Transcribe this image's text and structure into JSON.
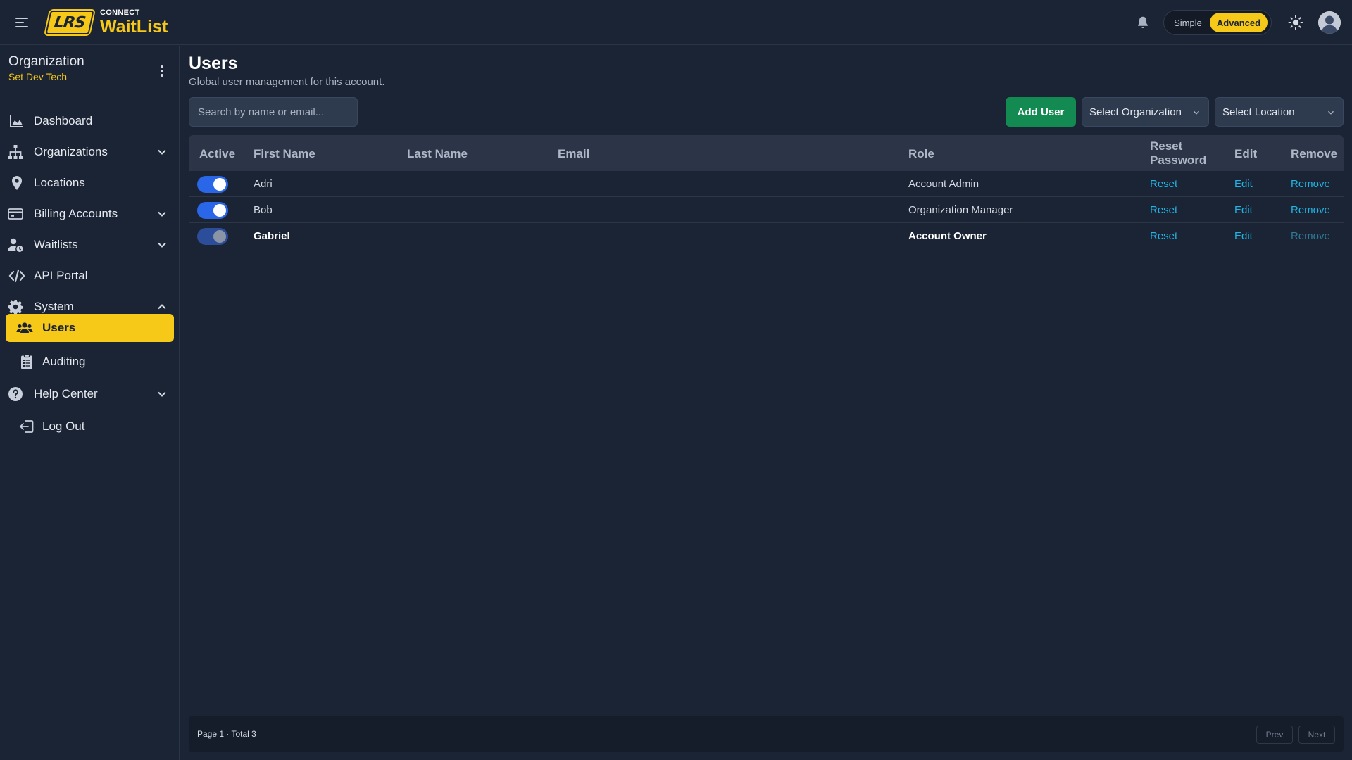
{
  "header": {
    "logo_text": "LRS",
    "brand_top": "CONNECT",
    "brand_main": "WaitList",
    "mode_simple": "Simple",
    "mode_advanced": "Advanced",
    "active_mode": "Advanced"
  },
  "sidebar": {
    "org_title": "Organization",
    "org_name": "Set Dev Tech",
    "items": [
      {
        "label": "Dashboard",
        "icon": "chart-area-icon"
      },
      {
        "label": "Organizations",
        "icon": "sitemap-icon",
        "expandable": true
      },
      {
        "label": "Locations",
        "icon": "map-pin-icon"
      },
      {
        "label": "Billing Accounts",
        "icon": "credit-card-icon",
        "expandable": true
      },
      {
        "label": "Waitlists",
        "icon": "user-clock-icon",
        "expandable": true
      },
      {
        "label": "API Portal",
        "icon": "code-icon"
      },
      {
        "label": "System",
        "icon": "gear-icon",
        "expandable": true,
        "expanded": true
      },
      {
        "label": "Users",
        "icon": "users-icon",
        "active": true
      },
      {
        "label": "Auditing",
        "icon": "clipboard-list-icon"
      },
      {
        "label": "Help Center",
        "icon": "question-circle-icon",
        "expandable": true
      },
      {
        "label": "Log Out",
        "icon": "logout-icon"
      }
    ]
  },
  "main": {
    "title": "Users",
    "subtitle": "Global user management for this account.",
    "search_placeholder": "Search by name or email...",
    "add_user_label": "Add User",
    "select_org_label": "Select Organization",
    "select_loc_label": "Select Location"
  },
  "table": {
    "headers": {
      "active": "Active",
      "first_name": "First Name",
      "last_name": "Last Name",
      "email": "Email",
      "role": "Role",
      "reset_password": [
        "Reset",
        "Password"
      ],
      "edit": "Edit",
      "remove": "Remove"
    },
    "rows": [
      {
        "active": true,
        "first_name": "Adri",
        "last_name": "",
        "email": "",
        "role": "Account Admin",
        "reset": "Reset",
        "edit": "Edit",
        "remove": "Remove",
        "current_user": false
      },
      {
        "active": true,
        "first_name": "Bob",
        "last_name": "",
        "email": "",
        "role": "Organization Manager",
        "reset": "Reset",
        "edit": "Edit",
        "remove": "Remove",
        "current_user": false
      },
      {
        "active": false,
        "first_name": "Gabriel",
        "last_name": "",
        "email": "",
        "role": "Account Owner",
        "reset": "Reset",
        "edit": "Edit",
        "remove": "Remove",
        "current_user": true
      }
    ]
  },
  "footer": {
    "page_info": "Page 1 · Total 3",
    "prev_label": "Prev",
    "next_label": "Next"
  },
  "colors": {
    "background": "#1b2434",
    "accent_yellow": "#f6c818",
    "add_user_green": "#138a52",
    "link_blue": "#1fb5e6",
    "toggle_blue": "#2a66e8"
  }
}
